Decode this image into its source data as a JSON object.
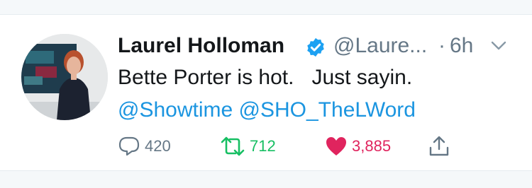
{
  "tweet": {
    "display_name": "Laurel Holloman",
    "handle": "@Laure...",
    "separator": "·",
    "time": "6h",
    "text": "Bette Porter is hot.   Just sayin.",
    "mentions": [
      "@Showtime",
      "@SHO_TheLWord"
    ],
    "replies": "420",
    "retweets": "712",
    "likes": "3,885"
  },
  "icons": {
    "verified": "verified-badge-icon",
    "caret": "chevron-down-icon",
    "reply": "reply-icon",
    "retweet": "retweet-icon",
    "like": "heart-icon",
    "share": "share-icon"
  },
  "colors": {
    "link": "#1b95e0",
    "retweet": "#17bf63",
    "like": "#e0245e",
    "muted": "#657786",
    "text": "#14171a"
  }
}
